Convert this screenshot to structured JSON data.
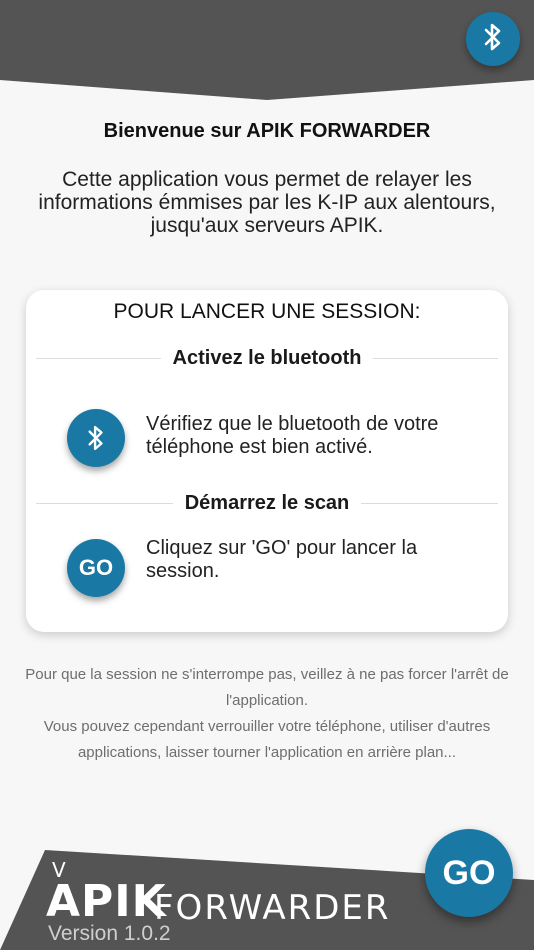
{
  "header": {
    "bluetooth_button_icon": "bluetooth-icon"
  },
  "welcome": {
    "title": "Bienvenue sur APIK FORWARDER",
    "intro": "Cette application vous permet de relayer les informations émmises par les K-IP aux alentours, jusqu'aux serveurs APIK."
  },
  "session_card": {
    "title": "POUR LANCER UNE SESSION:",
    "steps": [
      {
        "heading": "Activez le bluetooth",
        "icon": "bluetooth-icon",
        "text": "Vérifiez que le bluetooth de votre téléphone est bien activé."
      },
      {
        "heading": "Démarrez le scan",
        "icon_label": "GO",
        "text": "Cliquez sur 'GO' pour lancer la session."
      }
    ]
  },
  "footer_note": {
    "line1": "Pour que la session ne s'interrompe pas, veillez à ne pas forcer l'arrêt de l'application.",
    "line2": "Vous pouvez cependant verrouiller votre téléphone, utiliser d'autres applications, laisser tourner l'application en arrière plan..."
  },
  "brand": {
    "v": "V",
    "apik": "APIK",
    "forwarder": "FORWARDER",
    "version": "Version 1.0.2"
  },
  "go_button": {
    "label": "GO"
  },
  "colors": {
    "accent": "#1a78a4",
    "band": "#545454",
    "background": "#f7f7f8"
  }
}
